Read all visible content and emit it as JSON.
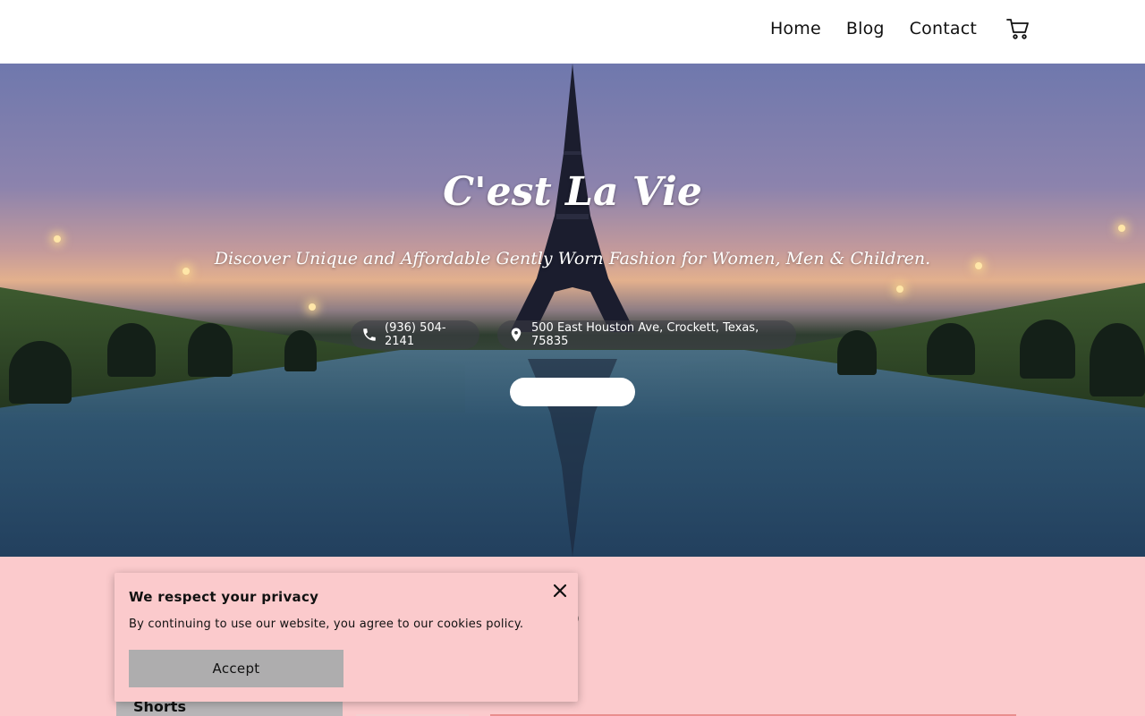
{
  "header": {
    "nav": [
      "Home",
      "Blog",
      "Contact"
    ],
    "cart_icon": "cart-icon"
  },
  "hero": {
    "title": "C'est La Vie",
    "subtitle": "Discover Unique and Affordable Gently Worn Fashion for Women, Men & Children.",
    "phone": "(936) 504-2141",
    "address": "500 East Houston Ave, Crockett, Texas, 75835",
    "phone_icon": "phone-icon",
    "address_icon": "map-pin-icon",
    "button_label": ""
  },
  "shop": {
    "heading_fragment": "op",
    "sidebar_item": "Shorts"
  },
  "cookie": {
    "title": "We respect your privacy",
    "text": "By continuing to use our website, you agree to our cookies policy.",
    "accept_label": "Accept",
    "close_icon": "close-icon"
  },
  "colors": {
    "pink_bg": "#fbcacc",
    "accept_bg": "#aeadae",
    "sidebar_bg": "#b7b5b7"
  }
}
